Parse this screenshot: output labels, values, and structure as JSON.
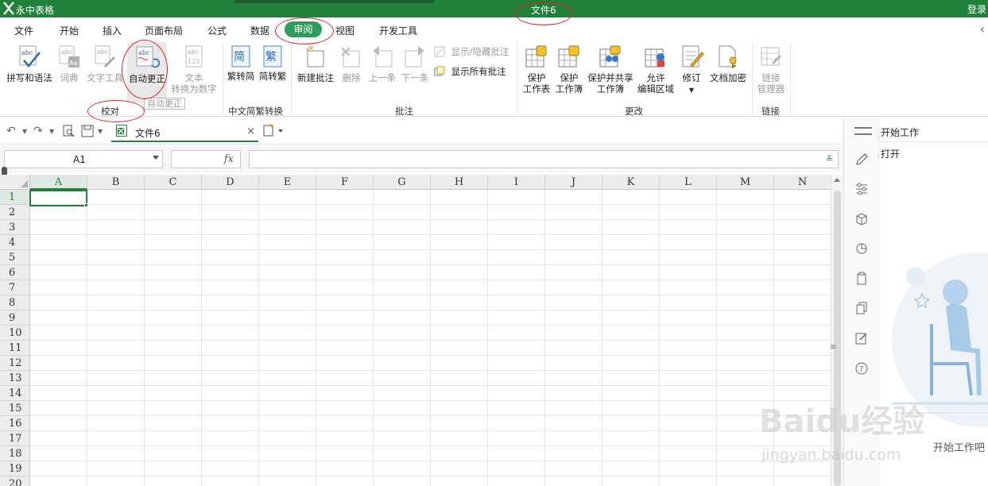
{
  "titlebar": {
    "app_name": "永中表格",
    "doc_title": "文件6",
    "login": "登录"
  },
  "menubar": {
    "items": [
      "文件",
      "开始",
      "插入",
      "页面布局",
      "公式",
      "数据",
      "审阅",
      "视图",
      "开发工具"
    ],
    "active": "审阅"
  },
  "ribbon": {
    "proofing": {
      "spelling": "拼写和语法",
      "dictionary": "词典",
      "text_tools": "文字工具",
      "autocorrect": "自动更正",
      "text_to_number_1": "文本",
      "text_to_number_2": "转换为数字",
      "group_label": "校对",
      "tooltip": "自动更正"
    },
    "chinese": {
      "trad_to_simp": "繁转简",
      "simp_to_trad": "简转繁",
      "group_label": "中文简繁转换",
      "icon_simp": "简",
      "icon_trad": "繁"
    },
    "comments": {
      "new_comment": "新建批注",
      "delete": "删除",
      "previous": "上一条",
      "next": "下一条",
      "show_hide": "显示/隐藏批注",
      "show_all": "显示所有批注",
      "group_label": "批注"
    },
    "changes": {
      "protect_sheet_1": "保护",
      "protect_sheet_2": "工作表",
      "protect_book_1": "保护",
      "protect_book_2": "工作簿",
      "protect_share_1": "保护并共享",
      "protect_share_2": "工作簿",
      "allow_edit_1": "允许",
      "allow_edit_2": "编辑区域",
      "revisions": "修订",
      "encrypt": "文档加密",
      "group_label": "更改"
    },
    "links": {
      "manager_1": "链接",
      "manager_2": "管理器",
      "group_label": "链接"
    }
  },
  "tabs": {
    "doc_tab": "文件6",
    "close": "×"
  },
  "formula_bar": {
    "name_box": "A1",
    "fx": "fx",
    "formula": ""
  },
  "sheet": {
    "columns": [
      "A",
      "B",
      "C",
      "D",
      "E",
      "F",
      "G",
      "H",
      "I",
      "J",
      "K",
      "L",
      "M",
      "N"
    ],
    "rows": [
      "1",
      "2",
      "3",
      "4",
      "5",
      "6",
      "7",
      "8",
      "9",
      "10",
      "11",
      "12",
      "13",
      "14",
      "15",
      "16",
      "17",
      "18",
      "19",
      "20"
    ],
    "active_col": "A",
    "active_row": "1"
  },
  "side_panel": {
    "title": "开始工作",
    "open": "打开",
    "footer": "开始工作吧"
  },
  "watermark": {
    "brand": "Baidu经验",
    "url": "jingyan.baidu.com"
  },
  "colors": {
    "brand": "#21813c",
    "active_tab": "#2e9c5b",
    "annotation": "#dd2222"
  }
}
